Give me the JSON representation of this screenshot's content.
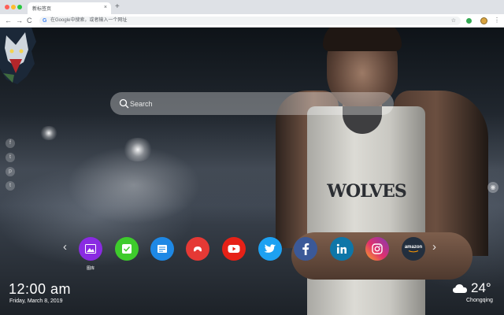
{
  "browser": {
    "tab_title": "新标签页",
    "tab_close": "×",
    "new_tab": "+",
    "back": "←",
    "forward": "→",
    "reload": "C",
    "omnibox_placeholder": "在Google中搜索，或者输入一个网址",
    "star": "☆",
    "menu": "⋮",
    "colors": {
      "tabstrip": "#dee1e6",
      "toolbar": "#ffffff"
    }
  },
  "page": {
    "jersey_text": "WOLVES",
    "search": {
      "placeholder": "Search",
      "icon": "search-icon"
    },
    "left_rail": [
      {
        "icon": "facebook-icon",
        "glyph": "f"
      },
      {
        "icon": "twitter-icon",
        "glyph": "t"
      },
      {
        "icon": "pinterest-icon",
        "glyph": "p"
      },
      {
        "icon": "tumblr-icon",
        "glyph": "t"
      }
    ],
    "right_rail": {
      "icon": "user-icon",
      "glyph": "◉"
    },
    "dock": {
      "prev": "‹",
      "next": "›",
      "apps": [
        {
          "name": "gallery",
          "color": "#8a2be2",
          "label": "图库"
        },
        {
          "name": "tasks",
          "color": "#3ecb2c"
        },
        {
          "name": "notes",
          "color": "#1e88e5"
        },
        {
          "name": "games",
          "color": "#e53935"
        },
        {
          "name": "youtube",
          "color": "#e62117"
        },
        {
          "name": "twitter",
          "color": "#1da1f2"
        },
        {
          "name": "facebook",
          "color": "#3b5998"
        },
        {
          "name": "linkedin",
          "color": "#0e76a8"
        },
        {
          "name": "instagram",
          "color": "#c13584"
        },
        {
          "name": "amazon",
          "color": "#232f3e",
          "text": "amazon"
        }
      ]
    },
    "clock": {
      "time": "12:00 am",
      "date": "Friday, March 8, 2019"
    },
    "weather": {
      "temp": "24°",
      "city": "Chongqing",
      "icon": "cloud-icon"
    }
  }
}
